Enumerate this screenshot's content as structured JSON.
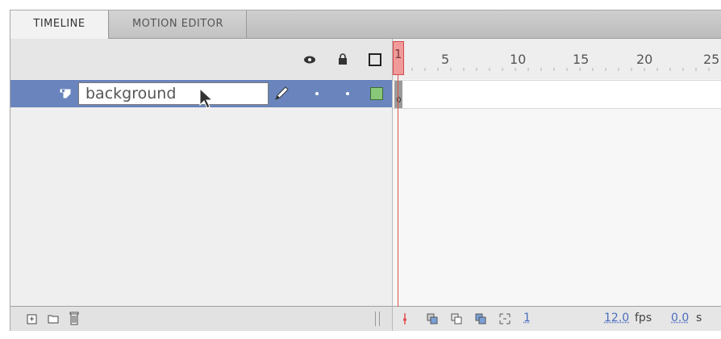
{
  "tabs": [
    {
      "label": "TIMELINE",
      "active": true
    },
    {
      "label": "MOTION EDITOR",
      "active": false
    }
  ],
  "header_icons": [
    "eye-icon",
    "lock-icon",
    "outline-icon"
  ],
  "layer": {
    "name_value": "background",
    "type_icon": "layer-icon",
    "edit_icon": "pencil-icon",
    "color": "#88c878"
  },
  "ruler": {
    "ticks": [
      "5",
      "10",
      "15",
      "20",
      "25"
    ]
  },
  "playhead": {
    "frame": "1"
  },
  "status": {
    "current_frame": "1",
    "fps_value": "12.0",
    "fps_unit": "fps",
    "time_value": "0.0",
    "time_unit": "s"
  },
  "colors": {
    "selected_layer": "#6a85bd",
    "playhead": "#e05050"
  }
}
